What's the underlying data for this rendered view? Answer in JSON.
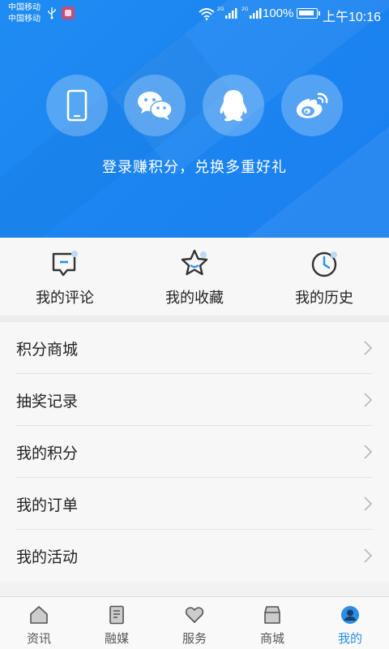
{
  "status_bar": {
    "carrier_1": "中国移动",
    "carrier_2": "中国移动",
    "net_1": "2G",
    "net_2": "2G",
    "battery": "100%",
    "time": "上午10:16"
  },
  "login": {
    "options": [
      {
        "icon": "phone-icon"
      },
      {
        "icon": "wechat-icon"
      },
      {
        "icon": "qq-icon"
      },
      {
        "icon": "weibo-icon"
      }
    ],
    "tip": "登录赚积分，兑换多重好礼"
  },
  "shortcuts": [
    {
      "label": "我的评论",
      "icon": "comment-icon"
    },
    {
      "label": "我的收藏",
      "icon": "star-icon"
    },
    {
      "label": "我的历史",
      "icon": "clock-icon"
    }
  ],
  "menu": [
    {
      "label": "积分商城"
    },
    {
      "label": "抽奖记录"
    },
    {
      "label": "我的积分"
    },
    {
      "label": "我的订单"
    },
    {
      "label": "我的活动"
    }
  ],
  "tabs": [
    {
      "label": "资讯",
      "icon": "home-icon",
      "active": false
    },
    {
      "label": "融媒",
      "icon": "document-icon",
      "active": false
    },
    {
      "label": "服务",
      "icon": "heart-icon",
      "active": false
    },
    {
      "label": "商城",
      "icon": "shop-icon",
      "active": false
    },
    {
      "label": "我的",
      "icon": "profile-icon",
      "active": true
    }
  ],
  "colors": {
    "header_blue": "#1c86f1",
    "active_tab": "#2a8ee8",
    "icon_dark": "#333333"
  }
}
